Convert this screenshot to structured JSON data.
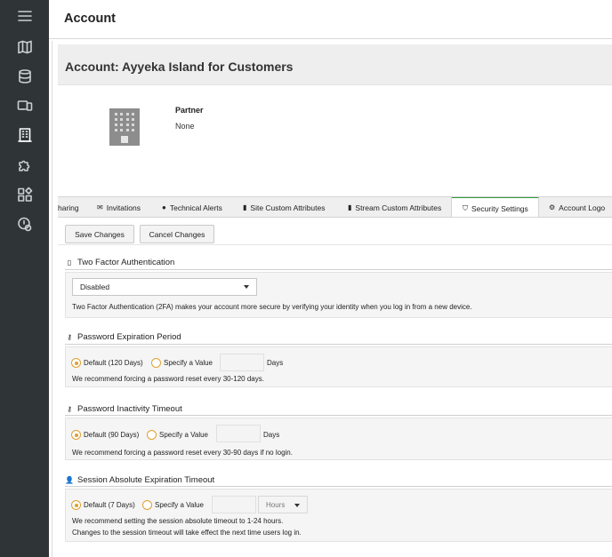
{
  "sidebar": {
    "icons": [
      "hamburger-icon",
      "map-icon",
      "database-icon",
      "devices-icon",
      "building-icon",
      "puzzle-icon",
      "widgets-icon",
      "alert-icon"
    ]
  },
  "header": {
    "title": "Account"
  },
  "account": {
    "title": "Account: Ayyeka Island for Customers",
    "partner_label": "Partner",
    "partner_value": "None"
  },
  "tabs": [
    {
      "label": "haring",
      "icon": ""
    },
    {
      "label": "Invitations",
      "icon": "envelope-icon"
    },
    {
      "label": "Technical Alerts",
      "icon": "info-icon"
    },
    {
      "label": "Site Custom Attributes",
      "icon": "bookmark-icon"
    },
    {
      "label": "Stream Custom Attributes",
      "icon": "bookmark-icon"
    },
    {
      "label": "Security Settings",
      "icon": "shield-icon"
    },
    {
      "label": "Account Logo",
      "icon": "gear-icon"
    }
  ],
  "buttons": {
    "save": "Save Changes",
    "cancel": "Cancel Changes"
  },
  "two_factor": {
    "title": "Two Factor Authentication",
    "selected": "Disabled",
    "description": "Two Factor Authentication (2FA) makes your account more secure by verifying your identity when you log in from a new device."
  },
  "password_expiration": {
    "title": "Password Expiration Period",
    "default_label": "Default (120 Days)",
    "specify_label": "Specify a Value",
    "unit": "Days",
    "note": "We recommend forcing a password reset every 30-120 days."
  },
  "password_inactivity": {
    "title": "Password Inactivity Timeout",
    "default_label": "Default (90 Days)",
    "specify_label": "Specify a Value",
    "unit": "Days",
    "note": "We recommend forcing a password reset every 30-90 days if no login."
  },
  "session_timeout": {
    "title": "Session Absolute Expiration Timeout",
    "default_label": "Default (7 Days)",
    "specify_label": "Specify a Value",
    "unit_select": "Hours",
    "note1": "We recommend setting the session absolute timeout to 1-24 hours.",
    "note2": "Changes to the session timeout will take effect the next time users log in."
  },
  "colors": {
    "sidebar_bg": "#2f3436",
    "active_tab_accent": "#2e9c3c",
    "radio_accent": "#e0a030"
  }
}
